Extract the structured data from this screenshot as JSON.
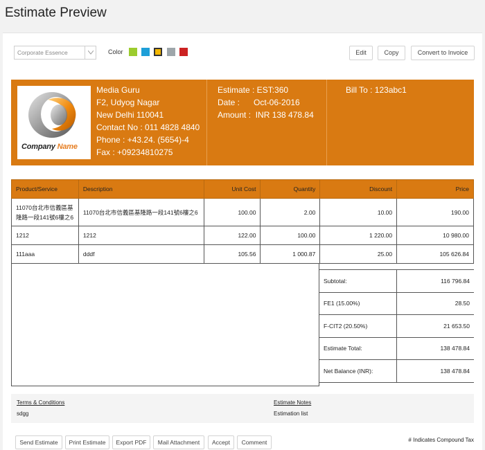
{
  "page": {
    "title": "Estimate Preview"
  },
  "toolbar": {
    "template": "Corporate Essence",
    "color_label": "Color",
    "swatches": [
      "#9ccc2e",
      "#1e9fd8",
      "#f5b800",
      "#9ea6aa",
      "#cc2222"
    ],
    "selected_swatch": "#f5b800",
    "edit": "Edit",
    "copy": "Copy",
    "convert": "Convert to Invoice"
  },
  "header": {
    "logo": {
      "text_1": "Company",
      "text_2": "Name"
    },
    "company": {
      "name": "Media Guru",
      "address1": "F2, Udyog Nagar",
      "address2": "New Delhi 110041",
      "contact": "Contact No : 011 4828 4840",
      "phone": "Phone : +43.24. (5654)-4",
      "fax": "Fax : +09234810275"
    },
    "estimate": "Estimate : EST:360",
    "date": "Date :      Oct-06-2016",
    "amount": "Amount :  INR 138 478.84",
    "bill_to": "Bill To : 123abc1",
    "accent": "#d97a12"
  },
  "items": {
    "headers": [
      "Product/Service",
      "Description",
      "Unit Cost",
      "Quantity",
      "Discount",
      "Price"
    ],
    "rows": [
      [
        "11070台北市信義區基隆路一段141號6樓之6",
        "11070台北市信義區基隆路一段141號6樓之6",
        "100.00",
        "2.00",
        "10.00",
        "190.00"
      ],
      [
        "1212",
        "1212",
        "122.00",
        "100.00",
        "1 220.00",
        "10 980.00"
      ],
      [
        "111aaa",
        "dddf",
        "105.56",
        "1 000.87",
        "25.00",
        "105 626.84"
      ]
    ]
  },
  "totals": [
    {
      "label": "Subtotal:",
      "value": "116 796.84"
    },
    {
      "label": "FE1 (15.00%)",
      "value": "28.50"
    },
    {
      "label": "F-CIT2 (20.50%)",
      "value": "21 653.50"
    },
    {
      "label": "Estimate Total:",
      "value": "138 478.84"
    },
    {
      "label": "Net Balance (INR):",
      "value": "138 478.84"
    }
  ],
  "terms": {
    "title": "Terms & Conditions",
    "text": "sdgg"
  },
  "notes": {
    "title": "Estimate Notes",
    "text": "Estimation list"
  },
  "actions": [
    "Send Estimate",
    "Print Estimate",
    "Export PDF",
    "Mail Attachment",
    "Accept",
    "Comment"
  ],
  "compound_note": "# Indicates Compound Tax"
}
